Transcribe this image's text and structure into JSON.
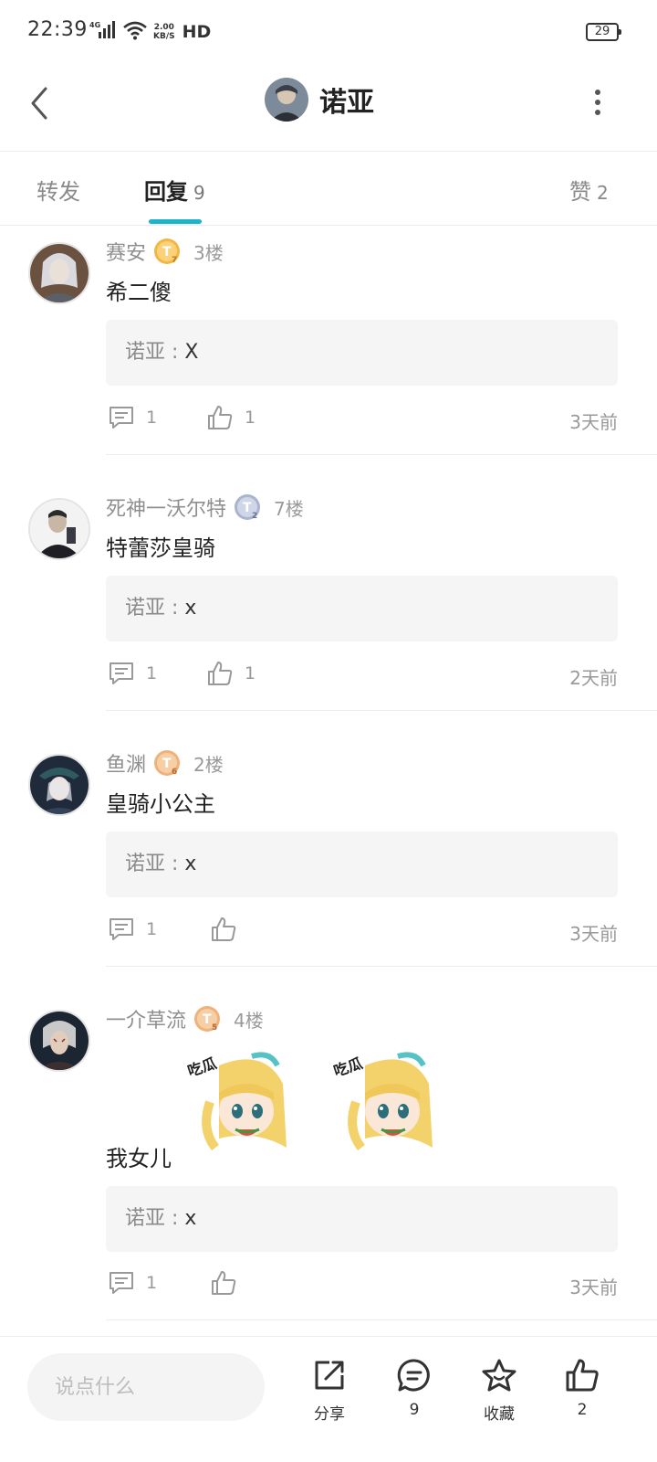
{
  "status_bar": {
    "time": "22:39",
    "network": "4G",
    "speed_value": "2.00",
    "speed_unit": "KB/S",
    "hd": "HD",
    "battery": "29"
  },
  "header": {
    "title": "诺亚"
  },
  "tabs": {
    "forward": {
      "label": "转发"
    },
    "reply": {
      "label": "回复",
      "count": "9"
    },
    "like": {
      "label": "赞",
      "count": "2"
    }
  },
  "replies": [
    {
      "user": "赛安",
      "badge_letter": "T",
      "badge_level": "7",
      "badge_color": "#f4b642",
      "floor": "3楼",
      "text": "希二傻",
      "quote_author": "诺亚",
      "quote_sep": " : ",
      "quote_text": "X",
      "comment_count": "1",
      "like_count": "1",
      "time": "3天前"
    },
    {
      "user": "死神一沃尔特",
      "badge_letter": "T",
      "badge_level": "2",
      "badge_color": "#aab4cf",
      "floor": "7楼",
      "text": "特蕾莎皇骑",
      "quote_author": "诺亚",
      "quote_sep": " : ",
      "quote_text": "x",
      "comment_count": "1",
      "like_count": "1",
      "time": "2天前"
    },
    {
      "user": "鱼渊",
      "badge_letter": "T",
      "badge_level": "6",
      "badge_color": "#f0b27a",
      "floor": "2楼",
      "text": "皇骑小公主",
      "quote_author": "诺亚",
      "quote_sep": " : ",
      "quote_text": "x",
      "comment_count": "1",
      "like_count": "",
      "time": "3天前"
    },
    {
      "user": "一介草流",
      "badge_letter": "T",
      "badge_level": "5",
      "badge_color": "#f0b27a",
      "floor": "4楼",
      "text": "我女儿",
      "quote_author": "诺亚",
      "quote_sep": " : ",
      "quote_text": "x",
      "comment_count": "1",
      "like_count": "",
      "time": "3天前",
      "sticker_caption": "吃瓜"
    }
  ],
  "bottom_bar": {
    "input_placeholder": "说点什么",
    "share_label": "分享",
    "comment_count": "9",
    "favorite_label": "收藏",
    "like_count": "2"
  },
  "colors": {
    "accent": "#1bb4c9",
    "muted_text": "#999999",
    "quote_bg": "#f5f5f5"
  }
}
